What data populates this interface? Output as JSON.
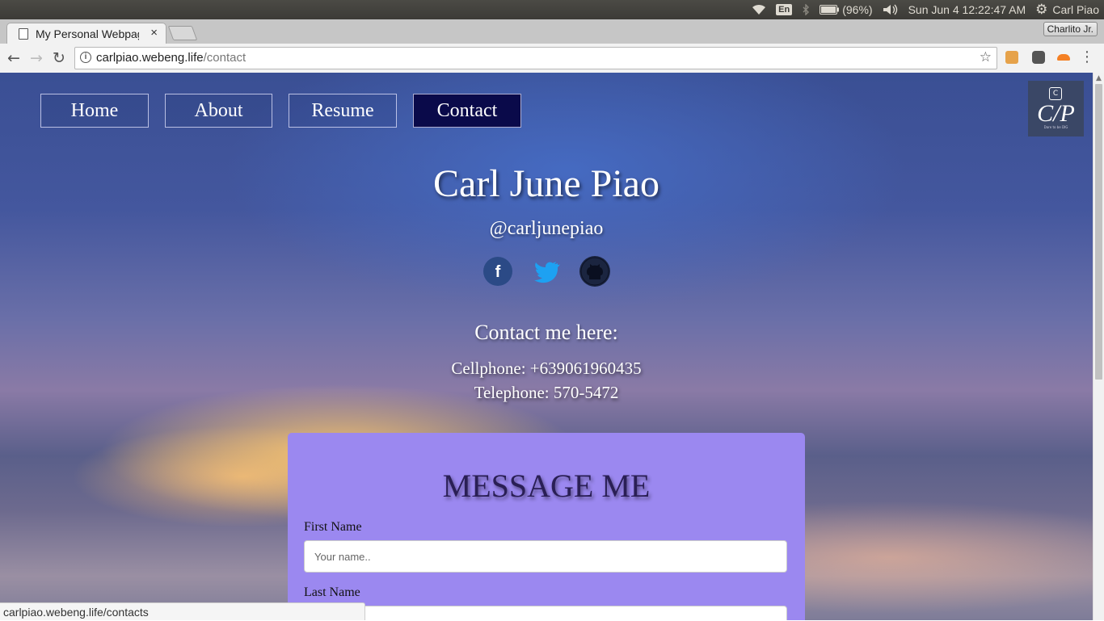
{
  "system_panel": {
    "language": "En",
    "battery": "(96%)",
    "clock": "Sun Jun  4 12:22:47 AM",
    "user": "Carl Piao",
    "icons": [
      "wifi-icon",
      "bluetooth-icon",
      "battery-icon",
      "volume-icon",
      "settings-gear-icon"
    ]
  },
  "browser": {
    "tab_title": "My Personal Webpage",
    "profile_name": "Charlito Jr.",
    "url_host": "carlpiao.webeng.life",
    "url_path": "/contact",
    "status_url": "carlpiao.webeng.life/contacts"
  },
  "nav": {
    "items": [
      {
        "label": "Home"
      },
      {
        "label": "About"
      },
      {
        "label": "Resume"
      },
      {
        "label": "Contact"
      }
    ],
    "active": "Contact"
  },
  "logo": {
    "letter": "C",
    "monogram": "C/P",
    "tagline": "Dare to be DIG"
  },
  "hero": {
    "name": "Carl June Piao",
    "handle": "@carljunepiao",
    "social": [
      "facebook-icon",
      "twitter-icon",
      "github-icon"
    ]
  },
  "contact": {
    "heading": "Contact me here:",
    "cellphone": "Cellphone: +639061960435",
    "telephone": "Telephone: 570-5472"
  },
  "form": {
    "title": "MESSAGE ME",
    "first_name_label": "First Name",
    "first_name_placeholder": "Your name..",
    "last_name_label": "Last Name"
  },
  "colors": {
    "nav_active": "#0a0a4a",
    "form_bg": "#9b88f0",
    "facebook": "#3b5998",
    "twitter": "#1da1f2",
    "github": "#24292e"
  }
}
